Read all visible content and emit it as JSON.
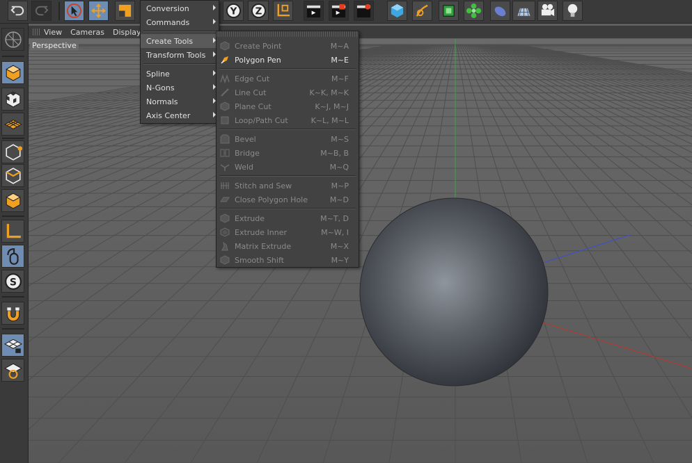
{
  "viewport": {
    "menu_items": [
      "View",
      "Cameras",
      "Display"
    ],
    "label": "Perspective"
  },
  "main_menu": {
    "items": [
      {
        "label": "Conversion",
        "submenu": true
      },
      {
        "label": "Commands",
        "submenu": true
      },
      {
        "label": "Create Tools",
        "submenu": true,
        "highlighted": true
      },
      {
        "label": "Transform Tools",
        "submenu": true
      },
      {
        "label": "Spline",
        "submenu": true
      },
      {
        "label": "N-Gons",
        "submenu": true
      },
      {
        "label": "Normals",
        "submenu": true
      },
      {
        "label": "Axis Center",
        "submenu": true
      }
    ]
  },
  "create_tools_menu": {
    "items": [
      {
        "label": "Create Point",
        "shortcut": "M~A",
        "enabled": false,
        "icon": "create-point-icon"
      },
      {
        "label": "Polygon Pen",
        "shortcut": "M~E",
        "enabled": true,
        "icon": "polygon-pen-icon"
      },
      {
        "label": "Edge Cut",
        "shortcut": "M~F",
        "enabled": false,
        "icon": "edge-cut-icon"
      },
      {
        "label": "Line Cut",
        "shortcut": "K~K, M~K",
        "enabled": false,
        "icon": "line-cut-icon"
      },
      {
        "label": "Plane Cut",
        "shortcut": "K~J, M~J",
        "enabled": false,
        "icon": "plane-cut-icon"
      },
      {
        "label": "Loop/Path Cut",
        "shortcut": "K~L, M~L",
        "enabled": false,
        "icon": "loop-cut-icon"
      },
      {
        "label": "Bevel",
        "shortcut": "M~S",
        "enabled": false,
        "icon": "bevel-icon"
      },
      {
        "label": "Bridge",
        "shortcut": "M~B, B",
        "enabled": false,
        "icon": "bridge-icon"
      },
      {
        "label": "Weld",
        "shortcut": "M~Q",
        "enabled": false,
        "icon": "weld-icon"
      },
      {
        "label": "Stitch and Sew",
        "shortcut": "M~P",
        "enabled": false,
        "icon": "stitch-icon"
      },
      {
        "label": "Close Polygon Hole",
        "shortcut": "M~D",
        "enabled": false,
        "icon": "close-hole-icon"
      },
      {
        "label": "Extrude",
        "shortcut": "M~T, D",
        "enabled": false,
        "icon": "extrude-icon"
      },
      {
        "label": "Extrude Inner",
        "shortcut": "M~W, I",
        "enabled": false,
        "icon": "extrude-inner-icon"
      },
      {
        "label": "Matrix Extrude",
        "shortcut": "M~X",
        "enabled": false,
        "icon": "matrix-extrude-icon"
      },
      {
        "label": "Smooth Shift",
        "shortcut": "M~Y",
        "enabled": false,
        "icon": "smooth-shift-icon"
      }
    ]
  },
  "toolbar": {
    "y_axis_label": "Y",
    "z_axis_label": "Z"
  },
  "colors": {
    "accent_selected": "#6f8cb3",
    "axis_x": "#c0342c",
    "axis_y": "#3fa04a",
    "axis_z": "#3b4fd0",
    "tool_orange": "#f0a020"
  }
}
